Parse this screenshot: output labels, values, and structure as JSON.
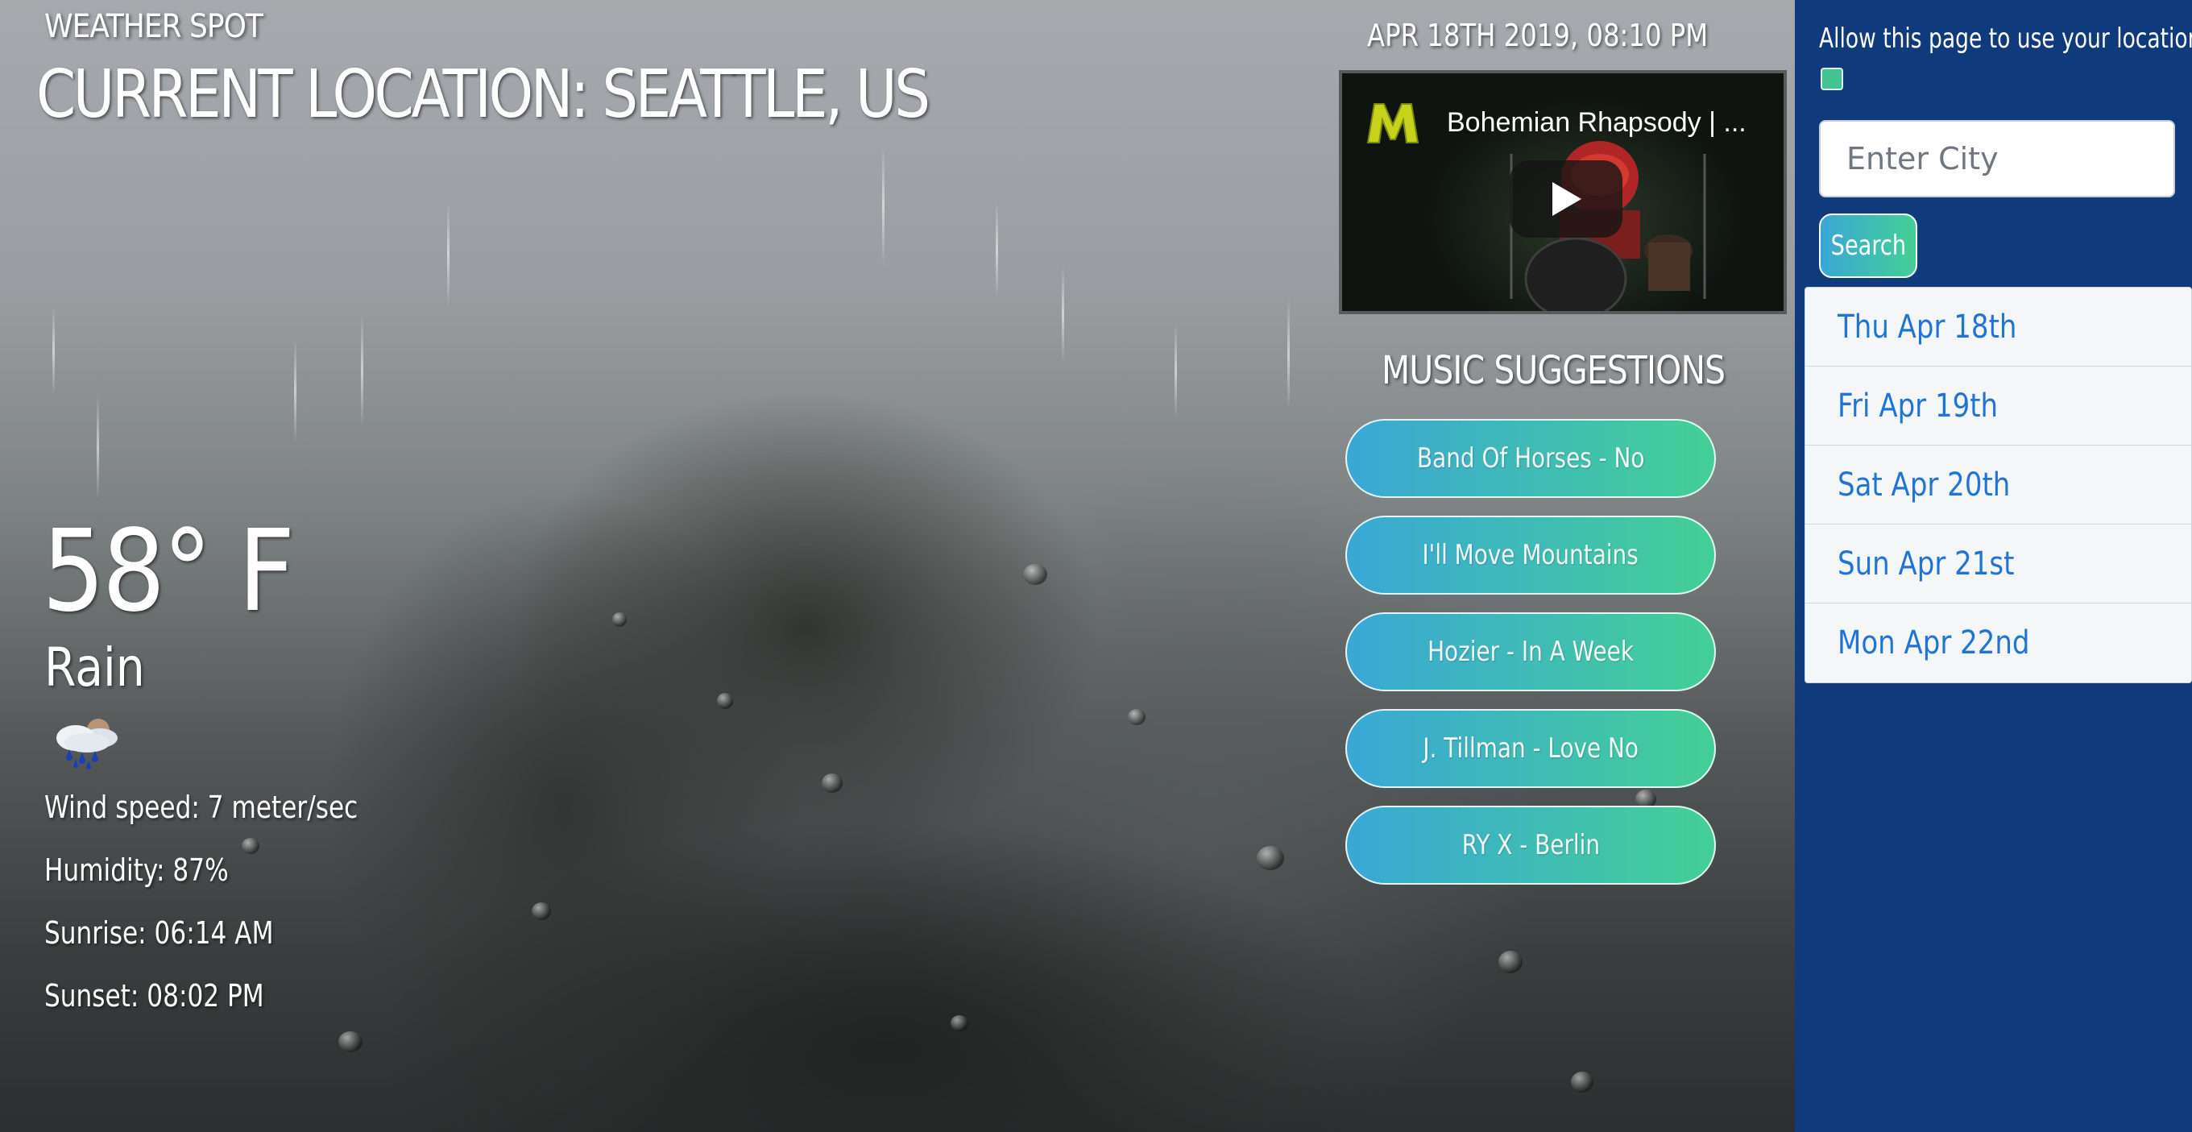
{
  "header": {
    "brand": "WEATHER SPOT",
    "location": "CURRENT LOCATION: SEATTLE, US",
    "datetime": "APR 18TH 2019, 08:10 PM"
  },
  "weather": {
    "temperature": "58° F",
    "condition": "Rain",
    "icon": "rain-cloud-icon",
    "details": [
      "Wind speed: 7 meter/sec",
      "Humidity: 87%",
      "Sunrise: 06:14 AM",
      "Sunset: 08:02 PM"
    ]
  },
  "video": {
    "title": "Bohemian Rhapsody | ...",
    "icon": "play-icon"
  },
  "music": {
    "title": "MUSIC SUGGESTIONS",
    "songs": [
      "Band Of Horses - No",
      "I'll Move Mountains",
      "Hozier - In A Week",
      "J. Tillman - Love No",
      "RY X - Berlin"
    ]
  },
  "sidebar": {
    "allow_location_label": "Allow this page to use your location",
    "allow_location_checked": true,
    "city_placeholder": "Enter City",
    "city_value": "",
    "search_label": "Search",
    "days": [
      "Thu Apr 18th",
      "Fri Apr 19th",
      "Sat Apr 20th",
      "Sun Apr 21st",
      "Mon Apr 22nd"
    ]
  },
  "colors": {
    "sidebar_bg": "#0f3b7c",
    "button_gradient_start": "#3aa7d6",
    "button_gradient_end": "#44cf96",
    "day_link": "#1f74d6"
  }
}
